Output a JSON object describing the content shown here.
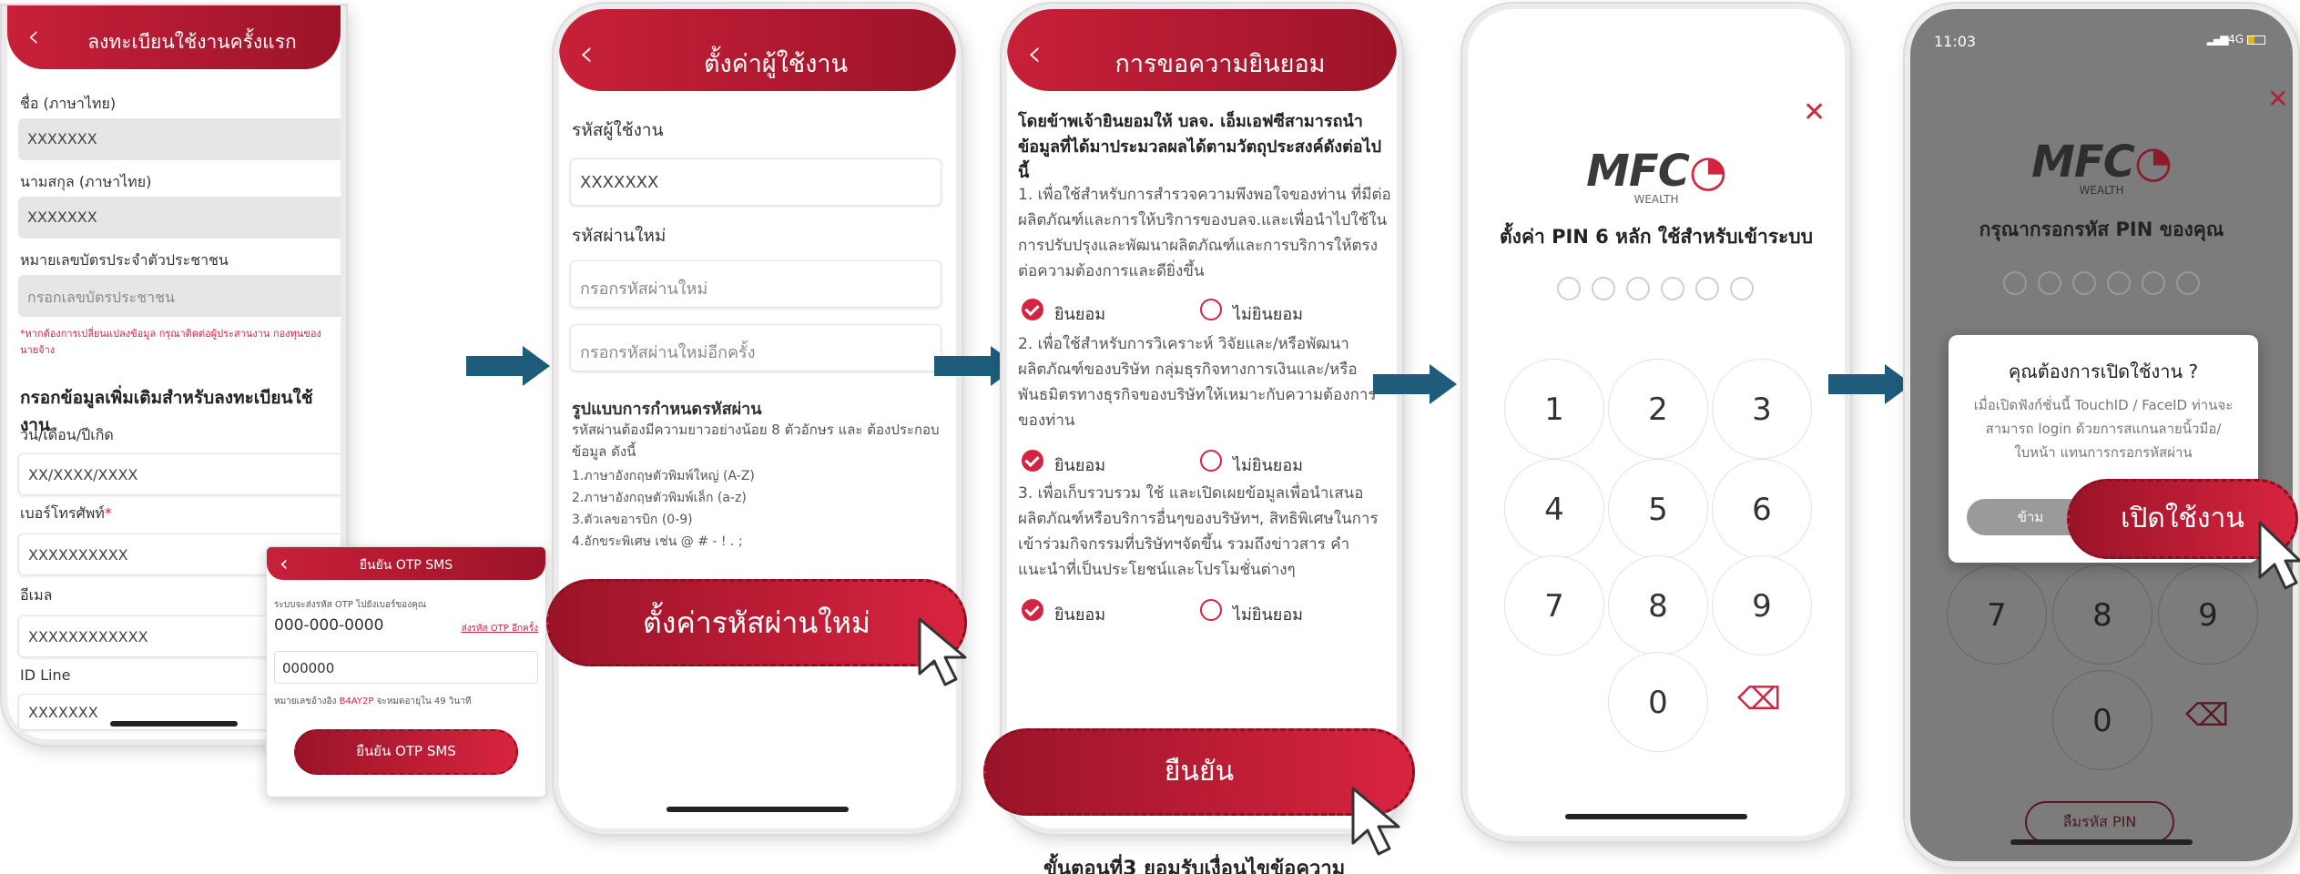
{
  "colors": {
    "brand_red": "#c8203a",
    "brand_dark_red": "#9c1428",
    "arrow_blue": "#1f5b7a"
  },
  "screen1": {
    "title": "ลงทะเบียนใช้งานครั้งแรก",
    "first_name_label": "ชื่อ (ภาษาไทย)",
    "first_name_value": "XXXXXXX",
    "last_name_label": "นามสกุล (ภาษาไทย)",
    "last_name_value": "XXXXXXX",
    "id_label": "หมายเลขบัตรประจำตัวประชาชน",
    "id_placeholder": "กรอกเลขบัตรประชาชน",
    "note": "*หากต้องการเปลี่ยนแปลงข้อมูล กรุณาติดต่อผู้ประสานงาน กองทุนของนายจ้าง",
    "section_title": "กรอกข้อมูลเพิ่มเติมสำหรับลงทะเบียนใช้งาน",
    "dob_label": "วัน/เดือน/ปีเกิด",
    "dob_value": "XX/XXXX/XXXX",
    "phone_label": "เบอร์โทรศัพท์",
    "phone_required": "*",
    "phone_value": "XXXXXXXXXX",
    "email_label": "อีเมล",
    "email_value": "XXXXXXXXXXXX",
    "line_label": "ID Line",
    "line_value": "XXXXXXX"
  },
  "otp_popup": {
    "title": "ยืนยัน OTP SMS",
    "info": "ระบบจะส่งรหัส OTP ไปยังเบอร์ของคุณ",
    "phone": "000-000-0000",
    "resend": "ส่งรหัส OTP อีกครั้ง",
    "code": "000000",
    "ref_prefix": "หมายเลขอ้างอิง",
    "ref_code": "B4AY2P",
    "ref_suffix": "จะหมดอายุใน 49 วินาที",
    "button": "ยืนยัน OTP SMS"
  },
  "screen2": {
    "title": "ตั้งค่าผู้ใช้งาน",
    "username_label": "รหัสผู้ใช้งาน",
    "username_value": "XXXXXXX",
    "password_label": "รหัสผ่านใหม่",
    "password_placeholder": "กรอกรหัสผ่านใหม่",
    "confirm_placeholder": "กรอกรหัสผ่านใหม่อีกครั้ง",
    "rules_title": "รูปแบบการกำหนดรหัสผ่าน",
    "rules_intro": "รหัสผ่านต้องมีความยาวอย่างน้อย 8 ตัวอักษร และ ต้องประกอบข้อมูล ดังนี้",
    "rules": [
      "1.ภาษาอังกฤษตัวพิมพ์ใหญ่ (A-Z)",
      "2.ภาษาอังกฤษตัวพิมพ์เล็ก (a-z)",
      "3.ตัวเลขอารบิก (0-9)",
      "4.อักขระพิเศษ เช่น @ # - ! . ;"
    ],
    "button": "ตั้งค่ารหัสผ่านใหม่"
  },
  "screen3": {
    "title": "การขอความยินยอม",
    "intro": "โดยข้าพเจ้ายินยอมให้ บลจ. เอ็มเอฟซีสามารถนำข้อมูลที่ได้มาประมวลผลได้ตามวัตถุประสงค์ดังต่อไปนี้",
    "items": [
      {
        "text": "1. เพื่อใช้สำหรับการสำรวจความพึงพอใจของท่าน ที่มีต่อผลิตภัณฑ์และการให้บริการของบลจ.และเพื่อนำไปใช้ในการปรับปรุงและพัฒนาผลิตภัณฑ์และการบริการให้ตรงต่อความต้องการและดียิ่งขึ้น",
        "agree": "ยินยอม",
        "disagree": "ไม่ยินยอม"
      },
      {
        "text": "2. เพื่อใช้สำหรับการวิเคราะห์ วิจัยและ/หรือพัฒนาผลิตภัณฑ์ของบริษัท กลุ่มธุรกิจทางการเงินและ/หรือพันธมิตรทางธุรกิจของบริษัทให้เหมาะกับความต้องการของท่าน",
        "agree": "ยินยอม",
        "disagree": "ไม่ยินยอม"
      },
      {
        "text": "3. เพื่อเก็บรวบรวม ใช้ และเปิดเผยข้อมูลเพื่อนำเสนอผลิตภัณฑ์หรือบริการอื่นๆของบริษัทฯ, สิทธิพิเศษในการเข้าร่วมกิจกรรมที่บริษัทฯจัดขึ้น รวมถึงข่าวสาร คำแนะนำที่เป็นประโยชน์และโปรโมชั่นต่างๆ",
        "agree": "ยินยอม",
        "disagree": "ไม่ยินยอม"
      }
    ],
    "button": "ยืนยัน",
    "caption": "ขั้นตอนที่3 ยอมรับเงื่อนไขข้อความ"
  },
  "screen4": {
    "logo_text": "MFC",
    "logo_sub": "WEALTH",
    "title": "ตั้งค่า PIN 6 หลัก ใช้สำหรับเข้าระบบ",
    "close": "✕",
    "keys": [
      "1",
      "2",
      "3",
      "4",
      "5",
      "6",
      "7",
      "8",
      "9",
      "0"
    ],
    "backspace_icon": "⌫"
  },
  "screen5": {
    "time": "11:03",
    "network": "4G",
    "logo_text": "MFC",
    "logo_sub": "WEALTH",
    "title": "กรุณากรอกรหัส PIN ของคุณ",
    "close": "✕",
    "dialog_title": "คุณต้องการเปิดใช้งาน ?",
    "dialog_body": "เมื่อเปิดฟังก์ชั่นนี้ TouchID / FaceID ท่านจะสามารถ login ด้วยการสแกนลายนิ้วมือ/ใบหน้า แทนการกรอกรหัสผ่าน",
    "skip": "ข้าม",
    "enable": "เปิดใช้งาน",
    "keys": [
      "7",
      "8",
      "9",
      "0"
    ],
    "forgot": "ลืมรหัส PIN"
  }
}
